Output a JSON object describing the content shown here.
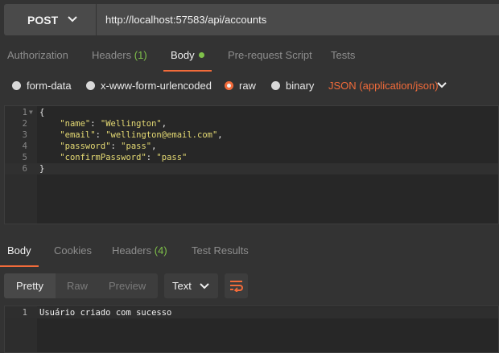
{
  "request": {
    "method": "POST",
    "url": "http://localhost:57583/api/accounts"
  },
  "request_tabs": {
    "authorization": "Authorization",
    "headers": "Headers",
    "headers_count": "(1)",
    "body": "Body",
    "pre_request": "Pre-request Script",
    "tests": "Tests"
  },
  "body_types": {
    "form_data": "form-data",
    "urlencoded": "x-www-form-urlencoded",
    "raw": "raw",
    "binary": "binary",
    "content_type": "JSON (application/json)",
    "selected": "raw"
  },
  "editor": {
    "lines": [
      {
        "n": "1",
        "text": "{"
      },
      {
        "n": "2",
        "key": "\"name\"",
        "val": "\"Wellington\"",
        "tail": ","
      },
      {
        "n": "3",
        "key": "\"email\"",
        "val": "\"wellington@email.com\"",
        "tail": ","
      },
      {
        "n": "4",
        "key": "\"password\"",
        "val": "\"pass\"",
        "tail": ","
      },
      {
        "n": "5",
        "key": "\"confirmPassword\"",
        "val": "\"pass\"",
        "tail": ""
      },
      {
        "n": "6",
        "text": "}"
      }
    ]
  },
  "response_tabs": {
    "body": "Body",
    "cookies": "Cookies",
    "headers": "Headers",
    "headers_count": "(4)",
    "test_results": "Test Results"
  },
  "response_toolbar": {
    "pretty": "Pretty",
    "raw": "Raw",
    "preview": "Preview",
    "format": "Text"
  },
  "response_body": {
    "line_number": "1",
    "text": "Usuário criado com sucesso"
  },
  "colors": {
    "accent": "#f26b3a",
    "success": "#7fc14a",
    "background": "#333333",
    "editor_bg": "#272727"
  }
}
